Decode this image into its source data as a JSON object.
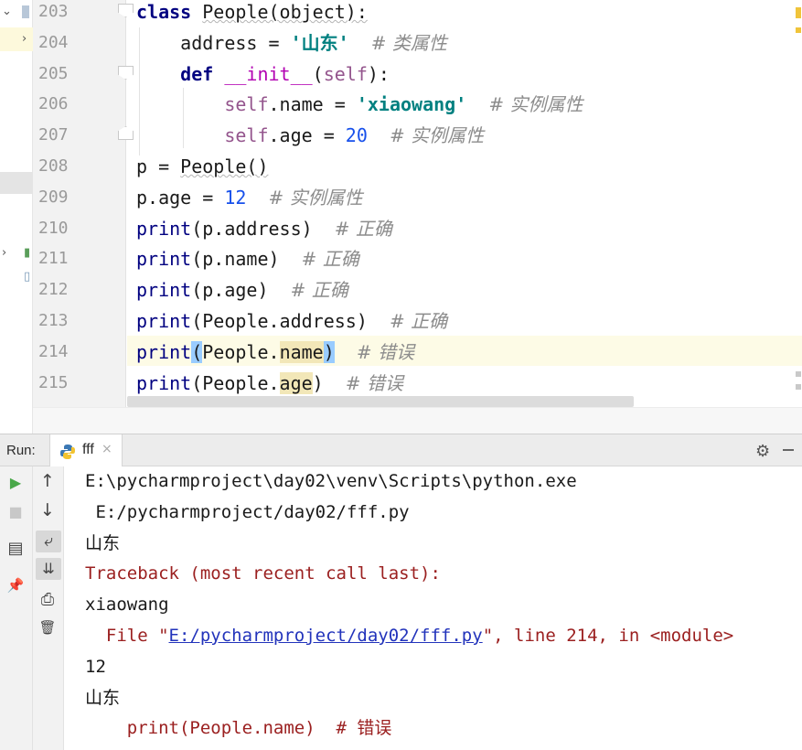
{
  "editor": {
    "lines": [
      {
        "no": "203",
        "segments": [
          {
            "t": "class ",
            "c": "kw"
          },
          {
            "t": "People(object):",
            "c": "squig"
          }
        ]
      },
      {
        "no": "204",
        "segments": [
          {
            "t": "    address = "
          },
          {
            "t": "'山东'",
            "c": "str"
          },
          {
            "t": "  "
          },
          {
            "t": "# 类属性",
            "c": "cmt"
          }
        ]
      },
      {
        "no": "205",
        "segments": [
          {
            "t": "    "
          },
          {
            "t": "def ",
            "c": "kw"
          },
          {
            "t": "__init__",
            "c": "dunder"
          },
          {
            "t": "("
          },
          {
            "t": "self",
            "c": "self"
          },
          {
            "t": "):"
          }
        ]
      },
      {
        "no": "206",
        "segments": [
          {
            "t": "        "
          },
          {
            "t": "self",
            "c": "self"
          },
          {
            "t": ".name = "
          },
          {
            "t": "'xiaowang'",
            "c": "str"
          },
          {
            "t": "  "
          },
          {
            "t": "# 实例属性",
            "c": "cmt"
          }
        ]
      },
      {
        "no": "207",
        "segments": [
          {
            "t": "        "
          },
          {
            "t": "self",
            "c": "self"
          },
          {
            "t": ".age = "
          },
          {
            "t": "20",
            "c": "num"
          },
          {
            "t": "  "
          },
          {
            "t": "# 实例属性",
            "c": "cmt"
          }
        ]
      },
      {
        "no": "208",
        "segments": [
          {
            "t": "p = "
          },
          {
            "t": "People()",
            "c": "squig"
          }
        ]
      },
      {
        "no": "209",
        "segments": [
          {
            "t": "p.age = "
          },
          {
            "t": "12",
            "c": "num"
          },
          {
            "t": "  "
          },
          {
            "t": "# 实例属性",
            "c": "cmt"
          }
        ]
      },
      {
        "no": "210",
        "segments": [
          {
            "t": "print",
            "c": "bi"
          },
          {
            "t": "(p.address)  "
          },
          {
            "t": "# 正确",
            "c": "cmt"
          }
        ]
      },
      {
        "no": "211",
        "segments": [
          {
            "t": "print",
            "c": "bi"
          },
          {
            "t": "(p.name)  "
          },
          {
            "t": "# 正确",
            "c": "cmt"
          }
        ]
      },
      {
        "no": "212",
        "segments": [
          {
            "t": "print",
            "c": "bi"
          },
          {
            "t": "(p.age)  "
          },
          {
            "t": "# 正确",
            "c": "cmt"
          }
        ]
      },
      {
        "no": "213",
        "segments": [
          {
            "t": "print",
            "c": "bi"
          },
          {
            "t": "(People.address)  "
          },
          {
            "t": "# 正确",
            "c": "cmt"
          }
        ]
      },
      {
        "no": "214",
        "segments": [
          {
            "t": "print",
            "c": "bi"
          },
          {
            "t": "(",
            "c": "brace-hl"
          },
          {
            "t": "People."
          },
          {
            "t": "name",
            "c": "occ"
          },
          {
            "t": ")",
            "c": "brace-hl"
          },
          {
            "t": "  "
          },
          {
            "t": "# 错误",
            "c": "cmt"
          }
        ]
      },
      {
        "no": "215",
        "segments": [
          {
            "t": "print",
            "c": "bi"
          },
          {
            "t": "(People."
          },
          {
            "t": "age",
            "c": "occ"
          },
          {
            "t": ")  "
          },
          {
            "t": "# 错误",
            "c": "cmt"
          }
        ]
      }
    ]
  },
  "run": {
    "label": "Run:",
    "tab_name": "fff",
    "tab_close": "×",
    "console": [
      {
        "text": "E:\\pycharmproject\\day02\\venv\\Scripts\\python.exe",
        "kind": "normal"
      },
      {
        "text": " E:/pycharmproject/day02/fff.py",
        "kind": "normal"
      },
      {
        "text": "山东",
        "kind": "normal"
      },
      {
        "text": "Traceback (most recent call last):",
        "kind": "err"
      },
      {
        "text": "xiaowang",
        "kind": "normal"
      },
      {
        "kind": "err-link",
        "pre": "  File \"",
        "link": "E:/pycharmproject/day02/fff.py",
        "post": "\", line 214, in <module>"
      },
      {
        "text": "12",
        "kind": "normal"
      },
      {
        "text": "山东",
        "kind": "normal"
      },
      {
        "text": "    print(People.name)  # 错误",
        "kind": "err"
      }
    ]
  },
  "icons": {
    "run": "▶",
    "stop": "■",
    "up": "↑",
    "down": "↓",
    "wrap": "⤶",
    "scroll_end": "⇊",
    "print": "⎙",
    "trash": "🗑",
    "pin": "📌",
    "layout": "▤",
    "gear": "⚙"
  },
  "colors": {
    "keyword": "#000080",
    "string": "#008080",
    "number": "#1750eb",
    "comment": "#8c8c8c",
    "self": "#94558d",
    "error": "#9b2020",
    "run_green": "#4aa84a"
  }
}
